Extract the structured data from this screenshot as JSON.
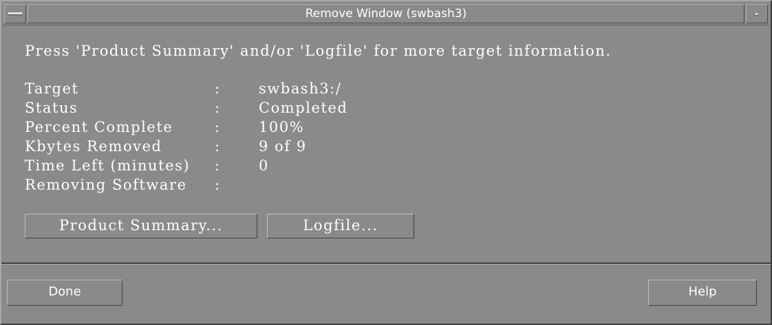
{
  "window": {
    "title": "Remove Window (swbash3)"
  },
  "intro_text": "Press 'Product Summary' and/or 'Logfile' for more target information.",
  "info": [
    {
      "label": "Target",
      "value": "swbash3:/"
    },
    {
      "label": "Status",
      "value": "Completed"
    },
    {
      "label": "Percent Complete",
      "value": "100%"
    },
    {
      "label": "Kbytes Removed",
      "value": "9 of 9"
    },
    {
      "label": "Time Left (minutes)",
      "value": "0"
    },
    {
      "label": "Removing Software",
      "value": ""
    }
  ],
  "info_separator": ":",
  "buttons": {
    "product_summary": "Product Summary...",
    "logfile": "Logfile...",
    "done": "Done",
    "help": "Help"
  },
  "icons": {
    "window_menu": "window-menu-icon",
    "minimize": "minimize-icon"
  },
  "colors": {
    "background": "#8a8a8a",
    "text": "#ffffff"
  }
}
